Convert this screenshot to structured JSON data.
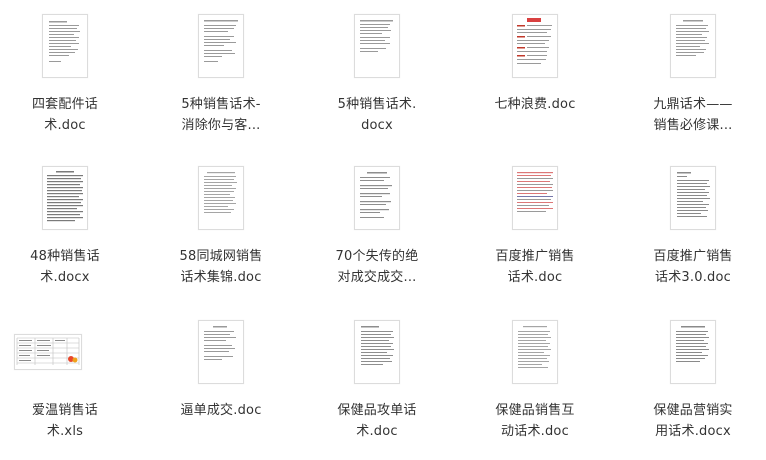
{
  "files": [
    {
      "line1": "四套配件话",
      "line2": "术.doc",
      "thumb": "plain-doc-icon"
    },
    {
      "line1": "5种销售话术-",
      "line2": "消除你与客...",
      "thumb": "plain-doc-icon"
    },
    {
      "line1": "5种销售话术.",
      "line2": "docx",
      "thumb": "plain-doc-icon"
    },
    {
      "line1": "七种浪费.doc",
      "line2": "",
      "thumb": "red-header-doc-icon"
    },
    {
      "line1": "九鼎话术——",
      "line2": "销售必修课...",
      "thumb": "plain-doc-icon"
    },
    {
      "line1": "48种销售话",
      "line2": "术.docx",
      "thumb": "dense-doc-icon"
    },
    {
      "line1": "58同城网销售",
      "line2": "话术集锦.doc",
      "thumb": "plain-doc-icon"
    },
    {
      "line1": "70个失传的绝",
      "line2": "对成交成交...",
      "thumb": "plain-doc-icon"
    },
    {
      "line1": "百度推广销售",
      "line2": "话术.doc",
      "thumb": "red-text-doc-icon"
    },
    {
      "line1": "百度推广销售",
      "line2": "话术3.0.doc",
      "thumb": "plain-doc-icon"
    },
    {
      "line1": "爱温销售话",
      "line2": "术.xls",
      "thumb": "spreadsheet-icon"
    },
    {
      "line1": "逼单成交.doc",
      "line2": "",
      "thumb": "plain-doc-icon"
    },
    {
      "line1": "保健品攻单话",
      "line2": "术.doc",
      "thumb": "plain-doc-icon"
    },
    {
      "line1": "保健品销售互",
      "line2": "动话术.doc",
      "thumb": "plain-doc-icon"
    },
    {
      "line1": "保健品营销实",
      "line2": "用话术.docx",
      "thumb": "plain-doc-icon"
    }
  ]
}
